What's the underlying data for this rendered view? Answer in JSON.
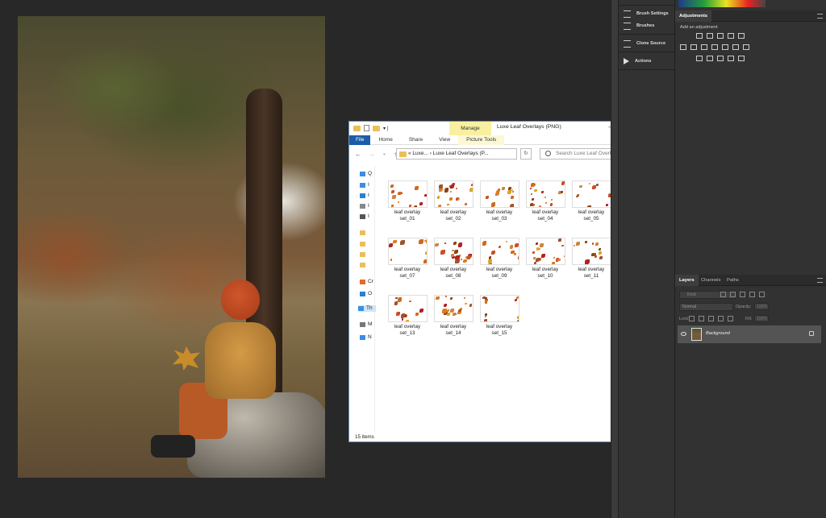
{
  "explorer": {
    "window_title": "Luxe Leaf Overlays (PNG)",
    "contextual_tab": "Manage",
    "ribbon_tabs": [
      "File",
      "Home",
      "Share",
      "View",
      "Picture Tools"
    ],
    "address": "«  Luxe...  ›  Luxe Leaf Overlays (P...",
    "search_placeholder": "Search Luxe Leaf Overlays (PNG)",
    "nav_items": [
      "Q",
      "I",
      "I",
      "I",
      "I",
      "",
      "",
      "",
      "",
      "Cr",
      "O",
      "Th",
      "M",
      "N"
    ],
    "files": [
      {
        "name": "leaf overlay set_01",
        "l1": "leaf overlay",
        "l2": "set_01"
      },
      {
        "name": "leaf overlay set_02",
        "l1": "leaf overlay",
        "l2": "set_02"
      },
      {
        "name": "leaf overlay set_03",
        "l1": "leaf overlay",
        "l2": "set_03"
      },
      {
        "name": "leaf overlay set_04",
        "l1": "leaf overlay",
        "l2": "set_04"
      },
      {
        "name": "leaf overlay set_05",
        "l1": "leaf overlay",
        "l2": "set_05"
      },
      {
        "name": "leaf overlay set_06",
        "l1": "leaf overlay",
        "l2": "set_06"
      },
      {
        "name": "leaf overlay set_07",
        "l1": "leaf overlay",
        "l2": "set_07"
      },
      {
        "name": "leaf overlay set_08",
        "l1": "leaf overlay",
        "l2": "set_08"
      },
      {
        "name": "leaf overlay set_09",
        "l1": "leaf overlay",
        "l2": "set_09"
      },
      {
        "name": "leaf overlay set_10",
        "l1": "leaf overlay",
        "l2": "set_10"
      },
      {
        "name": "leaf overlay set_11",
        "l1": "leaf overlay",
        "l2": "set_11"
      },
      {
        "name": "leaf overlay set_12",
        "l1": "leaf overlay",
        "l2": "set_12",
        "selected": true
      },
      {
        "name": "leaf overlay set_13",
        "l1": "leaf overlay",
        "l2": "set_13"
      },
      {
        "name": "leaf overlay set_14",
        "l1": "leaf overlay",
        "l2": "set_14"
      },
      {
        "name": "leaf overlay set_15",
        "l1": "leaf overlay",
        "l2": "set_15"
      }
    ],
    "status": "15 items"
  },
  "panels": {
    "brush_settings": "Brush Settings",
    "brushes": "Brushes",
    "clone_source": "Clone Source",
    "actions": "Actions",
    "adjustments_tab": "Adjustments",
    "add_adjustment": "Add an adjustment",
    "layers_tabs": [
      "Layers",
      "Channels",
      "Paths"
    ],
    "kind_placeholder": "Kind",
    "blend_mode": "Normal",
    "opacity_label": "Opacity:",
    "opacity_value": "100%",
    "lock_label": "Lock:",
    "fill_label": "Fill:",
    "fill_value": "100%",
    "layer_name": "Background"
  },
  "colors": {
    "file_tab": "#1a5da8",
    "manage_tab": "#f8f0a0",
    "selection": "#cde6f7",
    "ps_panel": "#323232"
  }
}
